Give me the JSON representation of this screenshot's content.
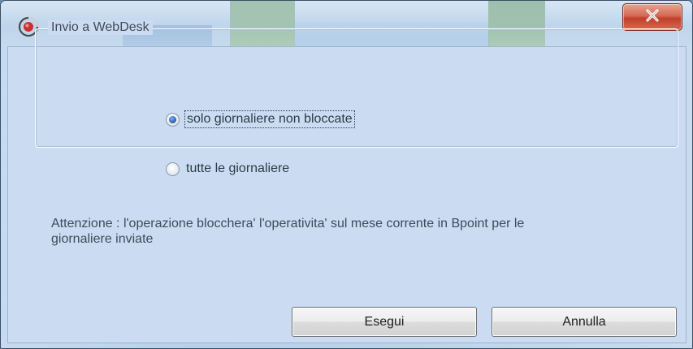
{
  "window": {
    "icon": "app-logo-icon",
    "close_icon": "close-icon",
    "close_glyph": "x"
  },
  "group": {
    "label": "Invio a WebDesk",
    "options": [
      {
        "label": "solo giornaliere non bloccate",
        "checked": true
      },
      {
        "label": "tutte le giornaliere",
        "checked": false
      }
    ]
  },
  "message": {
    "line1": "Attenzione : l'operazione bloccherа' l'operativita' sul mese corrente in Bpoint per le",
    "line2": "giornaliere inviate"
  },
  "buttons": {
    "execute": "Esegui",
    "cancel": "Annulla"
  },
  "colors": {
    "close_button": "#c0402c",
    "radio_checked": "#2c63b8",
    "client_background": "#cbdcf2"
  }
}
